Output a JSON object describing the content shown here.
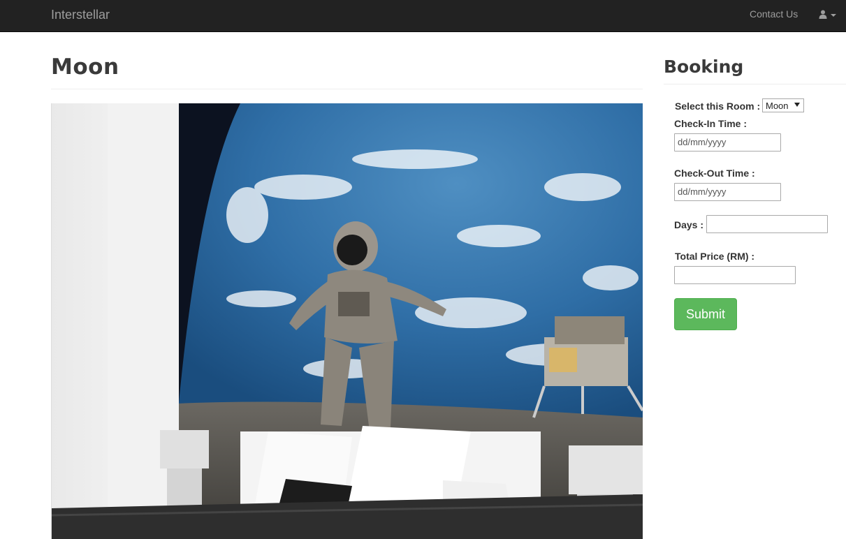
{
  "navbar": {
    "brand": "Interstellar",
    "contact_label": "Contact Us",
    "user_icon": "user-icon"
  },
  "room": {
    "title": "Moon",
    "image_alt": "Moon themed room: astronaut mural over Earth above a white bed"
  },
  "booking": {
    "title": "Booking",
    "select_room_label": "Select this Room :",
    "select_room_value": "Moon",
    "checkin_label": "Check-In Time :",
    "checkin_placeholder": "dd/mm/yyyy",
    "checkout_label": "Check-Out Time :",
    "checkout_placeholder": "dd/mm/yyyy",
    "days_label": "Days :",
    "days_value": "",
    "total_label": "Total Price (RM) :",
    "total_value": "",
    "submit_label": "Submit"
  },
  "colors": {
    "navbar_bg": "#222222",
    "nav_text": "#9d9d9d",
    "submit_bg": "#5cb85c"
  }
}
